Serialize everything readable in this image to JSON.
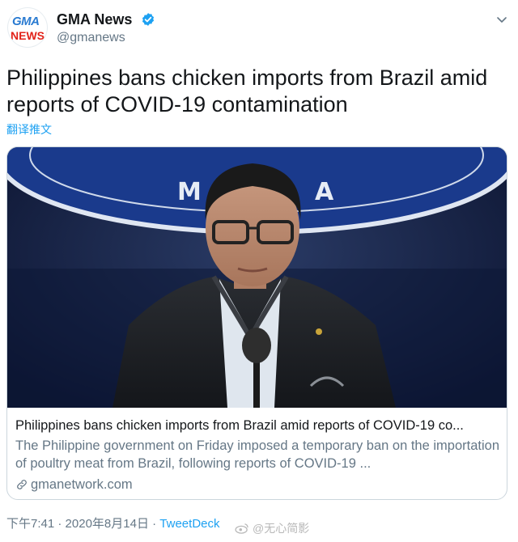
{
  "account": {
    "logo_top": "GMA",
    "logo_bottom": "NEWS",
    "name": "GMA News",
    "handle": "@gmanews"
  },
  "tweet": {
    "text": "Philippines bans chicken imports from Brazil amid reports of COVID-19 contamination",
    "translate_label": "翻译推文"
  },
  "card": {
    "title": "Philippines bans chicken imports from Brazil amid reports of COVID-19 co...",
    "description": "The Philippine government on Friday imposed a temporary ban on the importation of poultry meat from Brazil, following reports of COVID-19 ...",
    "domain": "gmanetwork.com"
  },
  "meta": {
    "time": "下午7:41",
    "separator1": " · ",
    "date": "2020年8月14日",
    "separator2": " · ",
    "source": "TweetDeck"
  },
  "watermark": {
    "text": "@无心简影"
  },
  "colors": {
    "accent": "#1da1f2",
    "secondary_text": "#657786",
    "logo_red": "#e2231a",
    "logo_blue": "#2a7bd1"
  }
}
